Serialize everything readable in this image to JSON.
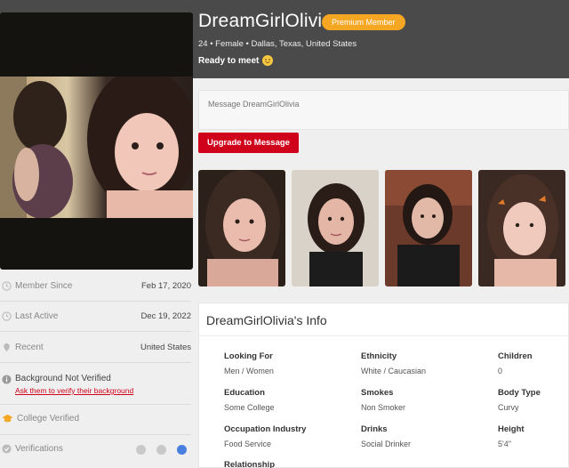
{
  "profile": {
    "name": "DreamGirlOlivia",
    "badge": "Premium Member",
    "meta": "24 • Female • Dallas, Texas, United States",
    "headline": "Ready to meet"
  },
  "sidebar": {
    "member_since_label": "Member Since",
    "member_since_value": "Feb 17, 2020",
    "last_active_label": "Last Active",
    "last_active_value": "Dec 19, 2022",
    "recent_label": "Recent",
    "recent_value": "United States",
    "background_title": "Background Not Verified",
    "background_link": "Ask them to verify their background",
    "college_label": "College Verified",
    "verifications_label": "Verifications"
  },
  "message": {
    "placeholder": "Message DreamGirlOlivia",
    "upgrade_label": "Upgrade to Message"
  },
  "info": {
    "title": "DreamGirlOlivia's Info",
    "fields": [
      {
        "label": "Looking For",
        "value": "Men / Women"
      },
      {
        "label": "Ethnicity",
        "value": "White / Caucasian"
      },
      {
        "label": "Children",
        "value": "0"
      },
      {
        "label": "Education",
        "value": "Some College"
      },
      {
        "label": "Smokes",
        "value": "Non Smoker"
      },
      {
        "label": "Body Type",
        "value": "Curvy"
      },
      {
        "label": "Occupation Industry",
        "value": "Food Service"
      },
      {
        "label": "Drinks",
        "value": "Social Drinker"
      },
      {
        "label": "Height",
        "value": "5'4\""
      },
      {
        "label": "Relationship",
        "value": ""
      }
    ]
  },
  "colors": {
    "header_bg": "#4a4a4a",
    "badge": "#f5a623",
    "accent_red": "#d0021b",
    "verified_blue": "#4a7fe0"
  },
  "icons": [
    "clock-icon",
    "location-pin-icon",
    "info-icon",
    "graduation-cap-icon",
    "check-circle-icon",
    "smiley-emoji-icon"
  ]
}
